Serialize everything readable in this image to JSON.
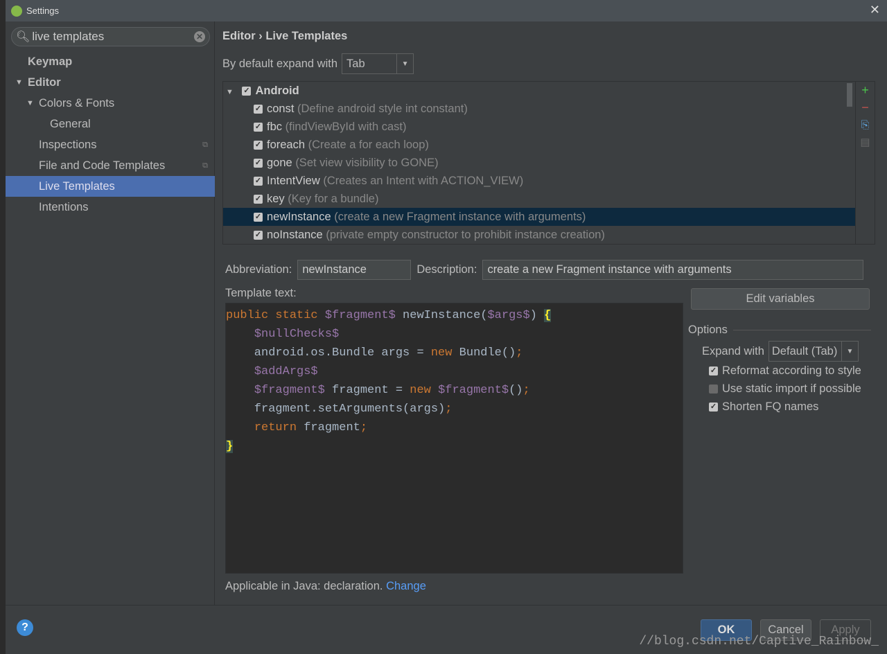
{
  "window": {
    "title": "Settings",
    "close": "✕"
  },
  "search": {
    "value": "live templates",
    "clear": "✕"
  },
  "sidebar": {
    "items": [
      {
        "label": "Keymap",
        "level": 0,
        "bold": true
      },
      {
        "label": "Editor",
        "level": 0,
        "bold": true,
        "expanded": true
      },
      {
        "label": "Colors & Fonts",
        "level": 1,
        "expanded": true
      },
      {
        "label": "General",
        "level": 2
      },
      {
        "label": "Inspections",
        "level": 1,
        "project": true
      },
      {
        "label": "File and Code Templates",
        "level": 1,
        "project": true
      },
      {
        "label": "Live Templates",
        "level": 1,
        "selected": true
      },
      {
        "label": "Intentions",
        "level": 1
      }
    ]
  },
  "main": {
    "breadcrumb": "Editor › Live Templates",
    "expand_label": "By default expand with",
    "expand_value": "Tab",
    "group": {
      "name": "Android",
      "checked": true
    },
    "templates": [
      {
        "name": "const",
        "desc": "(Define android style int constant)",
        "checked": true
      },
      {
        "name": "fbc",
        "desc": "(findViewById with cast)",
        "checked": true
      },
      {
        "name": "foreach",
        "desc": "(Create a for each loop)",
        "checked": true
      },
      {
        "name": "gone",
        "desc": "(Set view visibility to GONE)",
        "checked": true
      },
      {
        "name": "IntentView",
        "desc": "(Creates an Intent with ACTION_VIEW)",
        "checked": true
      },
      {
        "name": "key",
        "desc": "(Key for a bundle)",
        "checked": true
      },
      {
        "name": "newInstance",
        "desc": "(create a new Fragment instance with arguments)",
        "checked": true,
        "selected": true
      },
      {
        "name": "noInstance",
        "desc": "(private empty constructor to prohibit instance creation)",
        "checked": true
      }
    ],
    "tools": {
      "add": "+",
      "remove": "−",
      "copy": "⎘",
      "edit": "▤"
    },
    "abbreviation_label": "Abbreviation:",
    "abbreviation": "newInstance",
    "description_label": "Description:",
    "description": "create a new Fragment instance with arguments",
    "template_text_label": "Template text:",
    "code": [
      [
        [
          "kw",
          "public static "
        ],
        [
          "var",
          "$fragment$"
        ],
        [
          "pl",
          " newInstance("
        ],
        [
          "var",
          "$args$"
        ],
        [
          "pl",
          ") "
        ],
        [
          "br",
          "{"
        ]
      ],
      [
        [
          "pl",
          "    "
        ],
        [
          "var",
          "$nullChecks$"
        ]
      ],
      [
        [
          "pl",
          "    android.os.Bundle args = "
        ],
        [
          "kw",
          "new"
        ],
        [
          "pl",
          " Bundle()"
        ],
        [
          "kw",
          ";"
        ]
      ],
      [
        [
          "pl",
          "    "
        ],
        [
          "var",
          "$addArgs$"
        ]
      ],
      [
        [
          "pl",
          "    "
        ],
        [
          "var",
          "$fragment$"
        ],
        [
          "pl",
          " fragment = "
        ],
        [
          "kw",
          "new "
        ],
        [
          "var",
          "$fragment$"
        ],
        [
          "pl",
          "()"
        ],
        [
          "kw",
          ";"
        ]
      ],
      [
        [
          "pl",
          "    fragment.setArguments(args)"
        ],
        [
          "kw",
          ";"
        ]
      ],
      [
        [
          "pl",
          "    "
        ],
        [
          "kw",
          "return"
        ],
        [
          "pl",
          " fragment"
        ],
        [
          "kw",
          ";"
        ]
      ],
      [
        [
          "br",
          "}"
        ]
      ]
    ],
    "edit_variables": "Edit variables",
    "options": {
      "title": "Options",
      "expand_with_label": "Expand with",
      "expand_with_value": "Default (Tab)",
      "checkboxes": [
        {
          "label": "Reformat according to style",
          "checked": true
        },
        {
          "label": "Use static import if possible",
          "checked": false
        },
        {
          "label": "Shorten FQ names",
          "checked": true
        }
      ]
    },
    "applicable": "Applicable in Java: declaration.",
    "change": "Change"
  },
  "footer": {
    "help": "?",
    "ok": "OK",
    "cancel": "Cancel",
    "apply": "Apply"
  },
  "watermark": "//blog.csdn.net/Captive_Rainbow_"
}
